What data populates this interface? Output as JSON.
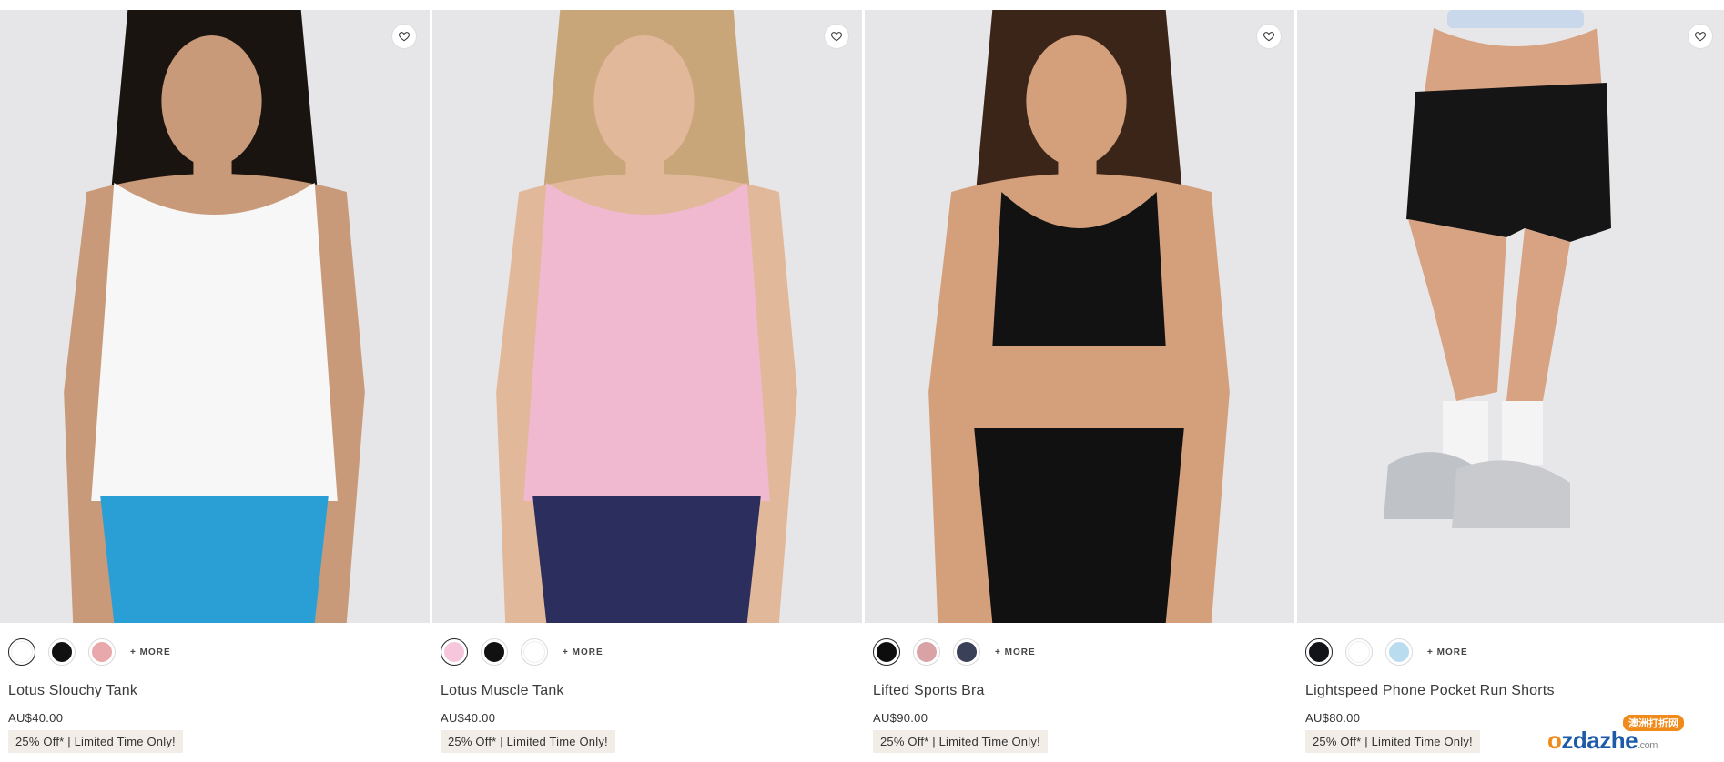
{
  "products": [
    {
      "name": "Lotus Slouchy Tank",
      "price": "AU$40.00",
      "promo": "25% Off* | Limited Time Only!",
      "more_label": "+ MORE",
      "swatches": [
        "#ffffff",
        "#111111",
        "#e9a8ab"
      ],
      "top_color": "#f7f7f8",
      "bottom_color": "#2a9fd6",
      "hair_color": "#1a1410",
      "skin_color": "#c99a7a"
    },
    {
      "name": "Lotus Muscle Tank",
      "price": "AU$40.00",
      "promo": "25% Off* | Limited Time Only!",
      "more_label": "+ MORE",
      "swatches": [
        "#f5c6dc",
        "#111111",
        "#ffffff"
      ],
      "top_color": "#f0b9d0",
      "bottom_color": "#2c2f5e",
      "hair_color": "#c9a57a",
      "skin_color": "#e2b89a"
    },
    {
      "name": "Lifted Sports Bra",
      "price": "AU$90.00",
      "promo": "25% Off* | Limited Time Only!",
      "more_label": "+ MORE",
      "swatches": [
        "#0d0d0d",
        "#d9a3a6",
        "#3a4057"
      ],
      "top_color": "#121212",
      "bottom_color": "#111111",
      "hair_color": "#3b2418",
      "skin_color": "#d4a07c"
    },
    {
      "name": "Lightspeed Phone Pocket Run Shorts",
      "price": "AU$80.00",
      "promo": "25% Off* | Limited Time Only!",
      "more_label": "+ MORE",
      "swatches": [
        "#111318",
        "#ffffff",
        "#b9dcef"
      ],
      "top_color": "#c9d8ea",
      "bottom_color": "#151515",
      "hair_color": "#000000",
      "skin_color": "#d7a382"
    }
  ],
  "watermark": {
    "cn_text": "澳洲打折网",
    "en_prefix": "o",
    "en_text": "zdazhe",
    "domain": ".com"
  }
}
